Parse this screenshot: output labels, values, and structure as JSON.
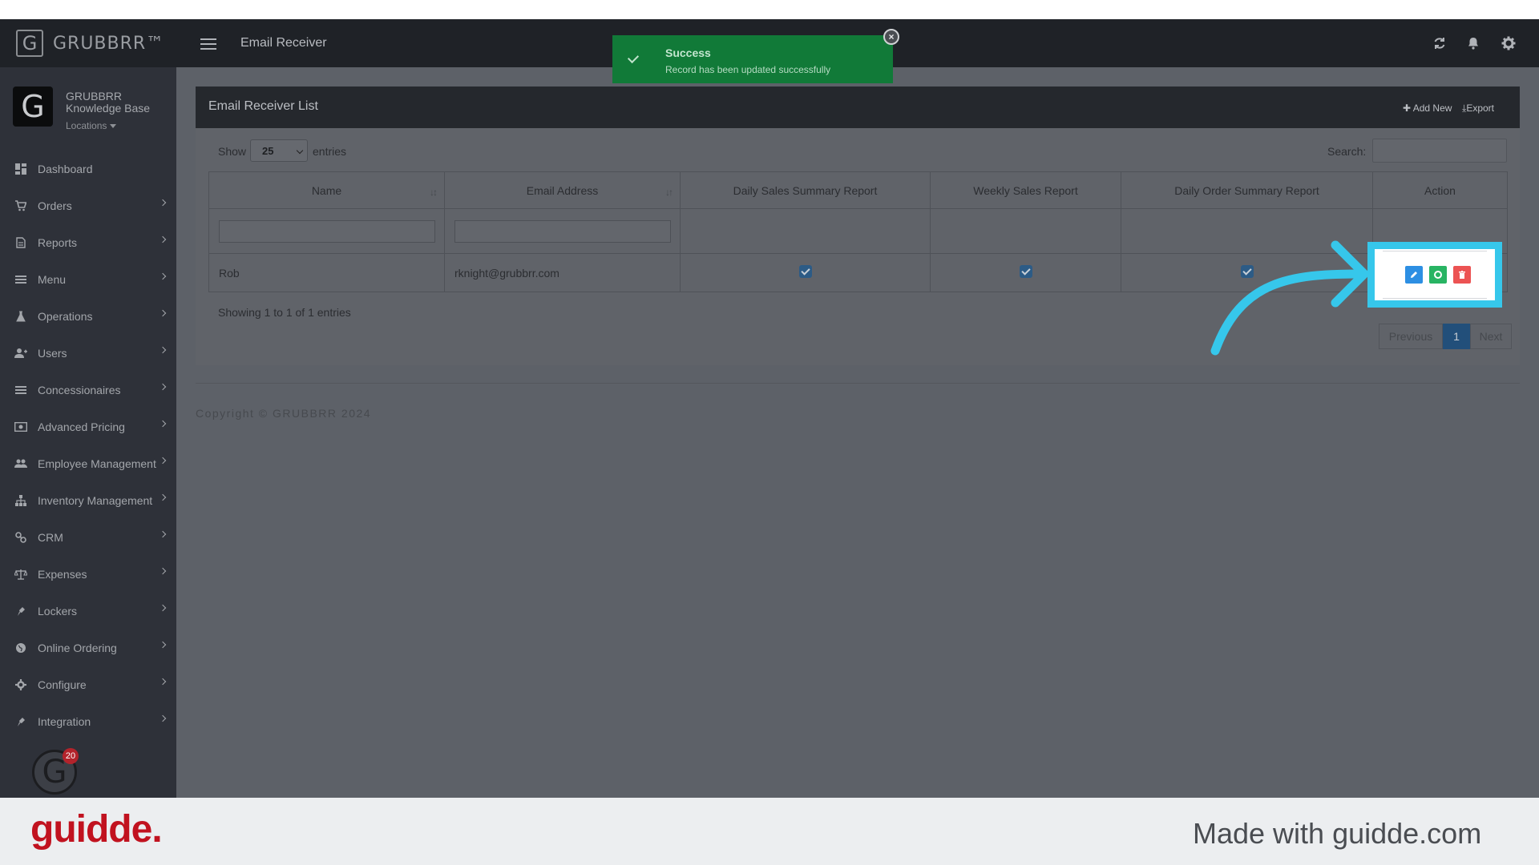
{
  "brand": {
    "letter": "G",
    "name": "GRUBBRR™"
  },
  "profile": {
    "letter": "G",
    "line1": "GRUBBRR",
    "line2": "Knowledge Base",
    "locations": "Locations"
  },
  "nav": [
    {
      "label": "Dashboard",
      "icon": "dashboard-icon",
      "has_submenu": false
    },
    {
      "label": "Orders",
      "icon": "cart-icon",
      "has_submenu": true
    },
    {
      "label": "Reports",
      "icon": "report-icon",
      "has_submenu": true
    },
    {
      "label": "Menu",
      "icon": "list-icon",
      "has_submenu": true
    },
    {
      "label": "Operations",
      "icon": "flask-icon",
      "has_submenu": true
    },
    {
      "label": "Users",
      "icon": "user-add-icon",
      "has_submenu": true
    },
    {
      "label": "Concessionaires",
      "icon": "list-icon",
      "has_submenu": true
    },
    {
      "label": "Advanced Pricing",
      "icon": "money-icon",
      "has_submenu": true
    },
    {
      "label": "Employee Management",
      "icon": "users-icon",
      "has_submenu": true
    },
    {
      "label": "Inventory Management",
      "icon": "sitemap-icon",
      "has_submenu": true
    },
    {
      "label": "CRM",
      "icon": "link-icon",
      "has_submenu": true
    },
    {
      "label": "Expenses",
      "icon": "balance-icon",
      "has_submenu": true
    },
    {
      "label": "Lockers",
      "icon": "plug-icon",
      "has_submenu": true
    },
    {
      "label": "Online Ordering",
      "icon": "globe-icon",
      "has_submenu": true
    },
    {
      "label": "Configure",
      "icon": "gear-icon",
      "has_submenu": true
    },
    {
      "label": "Integration",
      "icon": "plug-icon",
      "has_submenu": true
    }
  ],
  "bottom_avatar": {
    "letter": "G",
    "badge": "20"
  },
  "topbar": {
    "title": "Email Receiver"
  },
  "toast": {
    "title": "Success",
    "message": "Record has been updated successfully",
    "close": "×"
  },
  "panel": {
    "title": "Email Receiver List",
    "add_new": "Add New",
    "export": "Export",
    "show_label": "Show",
    "page_size": "25",
    "entries_label": "entries",
    "search_label": "Search:",
    "columns": [
      "Name",
      "Email Address",
      "Daily Sales Summary Report",
      "Weekly Sales Report",
      "Daily Order Summary Report",
      "Action"
    ],
    "rows": [
      {
        "name": "Rob",
        "email": "rknight@grubbrr.com",
        "daily_sales": true,
        "weekly_sales": true,
        "daily_order": true
      }
    ],
    "showing": "Showing 1 to 1 of 1 entries",
    "pagination": {
      "previous": "Previous",
      "current": "1",
      "next": "Next"
    }
  },
  "copyright": "Copyright © GRUBBRR 2024",
  "colors": {
    "highlight": "#36c7eb",
    "edit": "#2d8fe3",
    "activate": "#28b463",
    "delete": "#ec5353",
    "toast": "#117a38"
  },
  "footer": {
    "logo": "guidde.",
    "made_with": "Made with guidde.com"
  }
}
